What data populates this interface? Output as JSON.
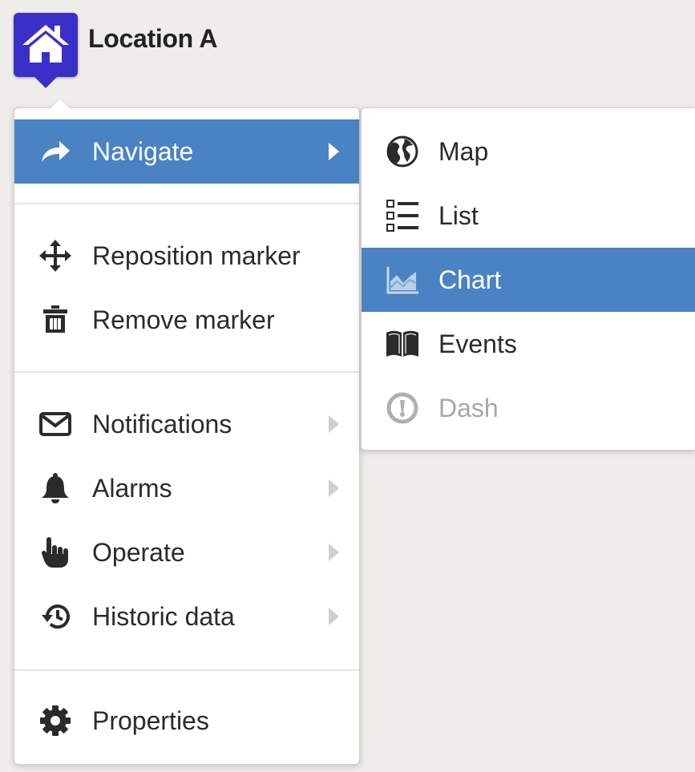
{
  "marker": {
    "icon": "home-icon",
    "title": "Location A",
    "color": "#3b2fc9"
  },
  "menu": {
    "items": [
      {
        "label": "Navigate",
        "icon": "share-arrow-icon",
        "has_submenu": true,
        "active": true
      },
      {
        "label": "Reposition marker",
        "icon": "move-arrows-icon",
        "has_submenu": false
      },
      {
        "label": "Remove marker",
        "icon": "trash-icon",
        "has_submenu": false
      },
      {
        "label": "Notifications",
        "icon": "envelope-icon",
        "has_submenu": true
      },
      {
        "label": "Alarms",
        "icon": "bell-icon",
        "has_submenu": true
      },
      {
        "label": "Operate",
        "icon": "hand-pointer-icon",
        "has_submenu": true
      },
      {
        "label": "Historic data",
        "icon": "history-clock-icon",
        "has_submenu": true
      },
      {
        "label": "Properties",
        "icon": "gear-icon",
        "has_submenu": false
      }
    ]
  },
  "submenu": {
    "items": [
      {
        "label": "Map",
        "icon": "globe-icon"
      },
      {
        "label": "List",
        "icon": "list-icon"
      },
      {
        "label": "Chart",
        "icon": "area-chart-icon",
        "active": true
      },
      {
        "label": "Events",
        "icon": "book-icon"
      },
      {
        "label": "Dash",
        "icon": "gauge-icon",
        "disabled": true
      }
    ]
  },
  "colors": {
    "accent": "#4a83c4",
    "background": "#efede9",
    "marker": "#3b2fc9",
    "disabled_text": "#a8a8a8"
  }
}
